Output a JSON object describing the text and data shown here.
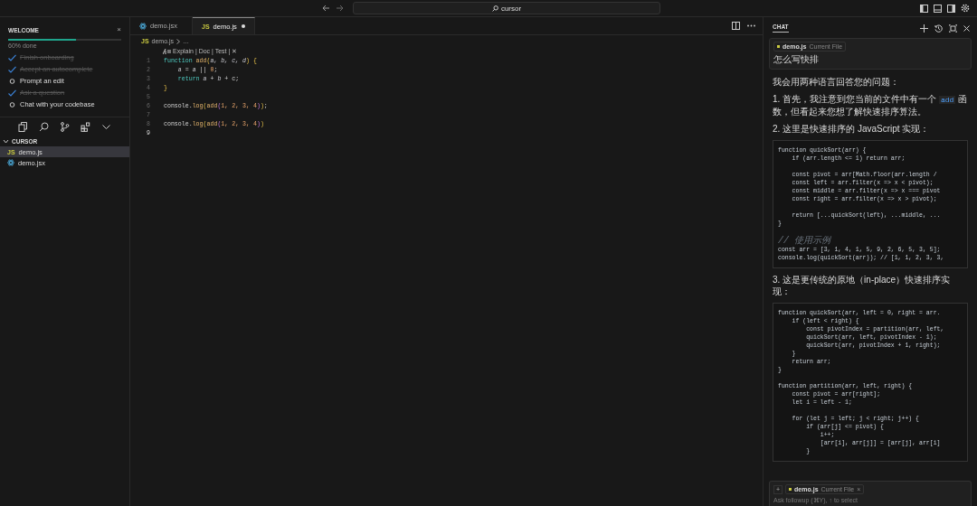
{
  "topbar": {
    "search": "cursor"
  },
  "sidebar": {
    "welcome": {
      "title": "WELCOME",
      "close": "×",
      "level": 0.6,
      "progress_text": "60% done",
      "tasks": [
        {
          "label": "Finish onboarding",
          "checked": true
        },
        {
          "label": "Accept an autocomplete",
          "checked": true
        },
        {
          "label": "Prompt an edit",
          "checked": false
        },
        {
          "label": "Ask a question",
          "checked": true
        },
        {
          "label": "Chat with your codebase",
          "checked": false
        }
      ]
    },
    "explorer": {
      "title": "CURSOR",
      "expanded": true,
      "files": [
        {
          "name": "demo.js",
          "kind": "js",
          "badge": "JS",
          "selected": true
        },
        {
          "name": "demo.jsx",
          "kind": "jsx",
          "selected": false
        }
      ]
    }
  },
  "editor": {
    "tabs": [
      {
        "name": "demo.jsx",
        "kind": "jsx",
        "selected": false,
        "modified": false
      },
      {
        "name": "demo.js",
        "kind": "js",
        "badge": "JS",
        "selected": true,
        "modified": true
      }
    ],
    "breadcrumb": {
      "badge": "JS",
      "file": "demo.js",
      "rest": "…"
    },
    "codelens": "Explain | Doc | Test | ✕",
    "lines": [
      {
        "number": "1",
        "current": false,
        "tokens": [
          {
            "text": "function",
            "kind": "keyword"
          },
          {
            "text": " add",
            "kind": "fn"
          },
          {
            "text": "(",
            "kind": "bracket"
          },
          {
            "text": "a, b, c, d",
            "kind": "param"
          },
          {
            "text": ")",
            "kind": "bracket"
          },
          {
            "text": " {",
            "kind": "bracket"
          }
        ]
      },
      {
        "number": "2",
        "current": false,
        "tokens": [
          {
            "text": "    a",
            "kind": "param"
          },
          {
            "text": " = ",
            "kind": "plain"
          },
          {
            "text": "a",
            "kind": "param"
          },
          {
            "text": " || ",
            "kind": "plain"
          },
          {
            "text": "0",
            "kind": "num"
          },
          {
            "text": ";",
            "kind": "plain"
          }
        ]
      },
      {
        "number": "3",
        "current": false,
        "tokens": [
          {
            "text": "    return",
            "kind": "keyword"
          },
          {
            "text": " a",
            "kind": "param"
          },
          {
            "text": " + ",
            "kind": "plain"
          },
          {
            "text": "b",
            "kind": "param"
          },
          {
            "text": " + c;",
            "kind": "plain"
          }
        ]
      },
      {
        "number": "4",
        "current": false,
        "tokens": [
          {
            "text": "}",
            "kind": "bracket"
          }
        ]
      },
      {
        "number": "5",
        "current": false
      },
      {
        "number": "6",
        "current": false,
        "tokens": [
          {
            "text": "console.",
            "kind": "plain"
          },
          {
            "text": "log",
            "kind": "fn"
          },
          {
            "text": "(",
            "kind": "bracket"
          },
          {
            "text": "add",
            "kind": "fn"
          },
          {
            "text": "(",
            "kind": "bracket2"
          },
          {
            "text": "1, 2, 3, 4",
            "kind": "num"
          },
          {
            "text": ")",
            "kind": "bracket2"
          },
          {
            "text": ")",
            "kind": "bracket"
          },
          {
            "text": ";",
            "kind": "plain"
          }
        ]
      },
      {
        "number": "7",
        "current": false
      },
      {
        "number": "8",
        "current": false,
        "tokens": [
          {
            "text": "console.",
            "kind": "plain"
          },
          {
            "text": "log",
            "kind": "fn"
          },
          {
            "text": "(",
            "kind": "bracket"
          },
          {
            "text": "add",
            "kind": "fn"
          },
          {
            "text": "(",
            "kind": "bracket2"
          },
          {
            "text": "1, 2, 3, 4",
            "kind": "num"
          },
          {
            "text": ")",
            "kind": "bracket2"
          },
          {
            "text": ")",
            "kind": "bracket"
          }
        ]
      },
      {
        "number": "9",
        "current": true
      }
    ]
  },
  "chat": {
    "tab": "CHAT",
    "prompt": {
      "chip_file": "demo.js",
      "chip_note": "Current File",
      "text": "怎么写快排"
    },
    "answer": [
      {
        "kind": "para",
        "parts": [
          {
            "text": "我会用两种语言回答您的问题："
          }
        ]
      },
      {
        "kind": "para",
        "parts": [
          {
            "text": "1. 首先，我注意到您当前的文件中有一个 "
          },
          {
            "text": "add",
            "code": true
          },
          {
            "text": " 函数，但看起来您想了解快速排序算法。"
          }
        ]
      },
      {
        "kind": "para",
        "parts": [
          {
            "text": "2. 这里是快速排序的 JavaScript 实现："
          }
        ]
      },
      {
        "kind": "code",
        "lines": [
          {
            "kind": "code",
            "text": "function quickSort(arr) {"
          },
          {
            "kind": "code",
            "text": "    if (arr.length <= 1) return arr;"
          },
          {
            "kind": "blank"
          },
          {
            "kind": "code",
            "text": "    const pivot = arr[Math.floor(arr.length /"
          },
          {
            "kind": "code",
            "text": "    const left = arr.filter(x => x < pivot);"
          },
          {
            "kind": "code",
            "text": "    const middle = arr.filter(x => x === pivot"
          },
          {
            "kind": "code",
            "text": "    const right = arr.filter(x => x > pivot);"
          },
          {
            "kind": "blank"
          },
          {
            "kind": "code",
            "text": "    return [...quickSort(left), ...middle, ..."
          },
          {
            "kind": "code",
            "text": "}"
          },
          {
            "kind": "blank"
          },
          {
            "kind": "comment",
            "text": "// 使用示例"
          },
          {
            "kind": "code",
            "text": "const arr = [3, 1, 4, 1, 5, 9, 2, 6, 5, 3, 5];"
          },
          {
            "kind": "code",
            "text": "console.log(quickSort(arr)); // [1, 1, 2, 3, 3,"
          }
        ]
      },
      {
        "kind": "para",
        "parts": [
          {
            "text": "3. 这是更传统的原地（in-place）快速排序实现："
          }
        ]
      },
      {
        "kind": "code",
        "lines": [
          {
            "kind": "code",
            "text": "function quickSort(arr, left = 0, right = arr."
          },
          {
            "kind": "code",
            "text": "    if (left < right) {"
          },
          {
            "kind": "code",
            "text": "        const pivotIndex = partition(arr, left,"
          },
          {
            "kind": "code",
            "text": "        quickSort(arr, left, pivotIndex - 1);"
          },
          {
            "kind": "code",
            "text": "        quickSort(arr, pivotIndex + 1, right);"
          },
          {
            "kind": "code",
            "text": "    }"
          },
          {
            "kind": "code",
            "text": "    return arr;"
          },
          {
            "kind": "code",
            "text": "}"
          },
          {
            "kind": "blank"
          },
          {
            "kind": "code",
            "text": "function partition(arr, left, right) {"
          },
          {
            "kind": "code",
            "text": "    const pivot = arr[right];"
          },
          {
            "kind": "code",
            "text": "    let i = left - 1;"
          },
          {
            "kind": "blank"
          },
          {
            "kind": "code",
            "text": "    for (let j = left; j < right; j++) {"
          },
          {
            "kind": "code",
            "text": "        if (arr[j] <= pivot) {"
          },
          {
            "kind": "code",
            "text": "            i++;"
          },
          {
            "kind": "code",
            "text": "            [arr[i], arr[j]] = [arr[j], arr[i]"
          },
          {
            "kind": "code",
            "text": "        }"
          }
        ]
      }
    ],
    "followup": {
      "add": "+",
      "chip_file": "demo.js",
      "chip_note": "Current File",
      "chip_close": "×",
      "placeholder": "Ask followup (⌘Y), ↑ to select"
    }
  }
}
